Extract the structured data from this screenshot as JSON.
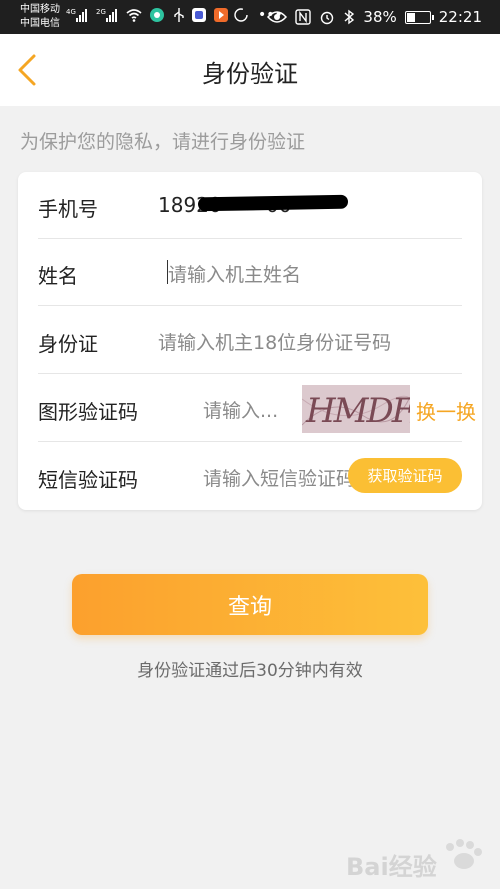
{
  "status_bar": {
    "carrier1": "中国移动",
    "carrier2": "中国电信",
    "sig1": "4G",
    "sig2": "2G",
    "battery_text": "38%",
    "battery_level": 0.38,
    "time": "22:21"
  },
  "header": {
    "title": "身份验证"
  },
  "hint": "为保护您的隐私，请进行身份验证",
  "form": {
    "phone": {
      "label": "手机号",
      "value": "18920",
      "suffix": "00"
    },
    "name": {
      "label": "姓名",
      "placeholder": "请输入机主姓名"
    },
    "id_card": {
      "label": "身份证",
      "placeholder": "请输入机主18位身份证号码"
    },
    "captcha": {
      "label": "图形验证码",
      "placeholder": "请输入...",
      "image_text": "HMDF",
      "swap_label": "换一换"
    },
    "sms": {
      "label": "短信验证码",
      "placeholder": "请输入短信验证码",
      "button_label": "获取验证码"
    }
  },
  "query_button": "查询",
  "validity_note": "身份验证通过后30分钟内有效",
  "watermark": "Bai经验",
  "colors": {
    "accent": "#f5a623",
    "button_start": "#fca02d",
    "button_end": "#fdc03a"
  }
}
